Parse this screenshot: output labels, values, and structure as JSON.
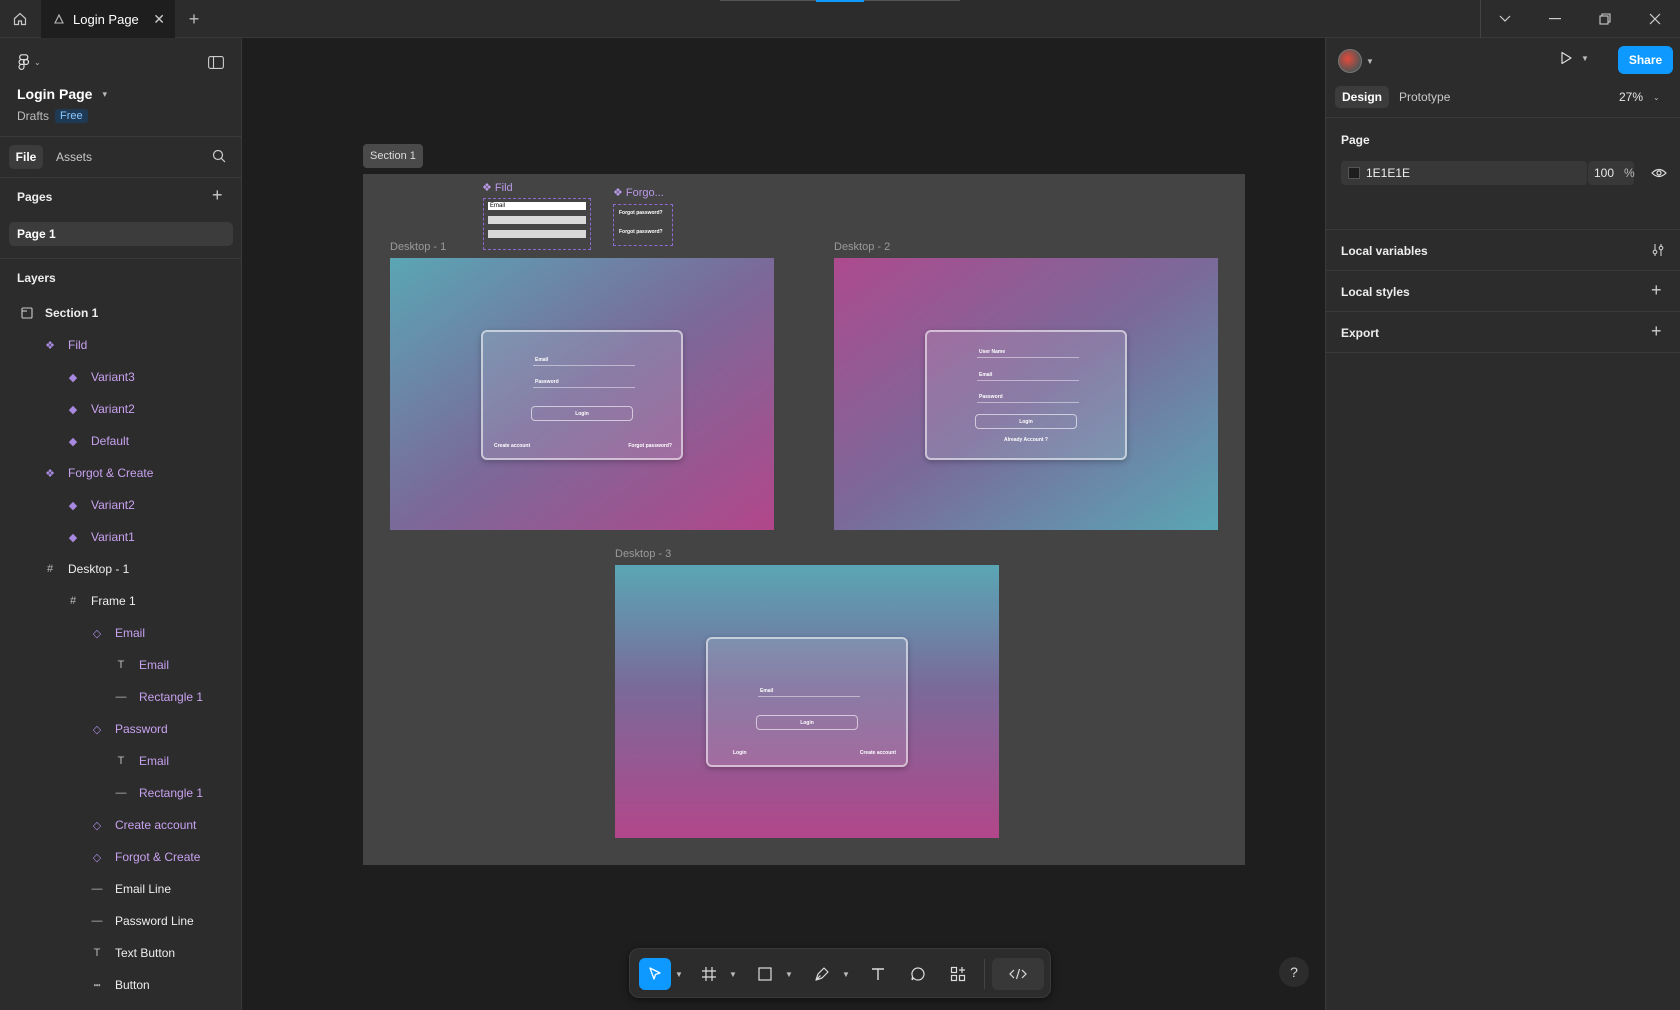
{
  "titlebar": {
    "tab_title": "Login Page"
  },
  "file": {
    "name": "Login Page",
    "location": "Drafts",
    "plan_badge": "Free"
  },
  "left_tabs": {
    "file": "File",
    "assets": "Assets"
  },
  "pages": {
    "header": "Pages",
    "items": [
      "Page 1"
    ]
  },
  "layers": {
    "header": "Layers",
    "items": [
      {
        "label": "Section 1",
        "icon": "section-icon"
      },
      {
        "label": "Fild",
        "icon": "component-set-icon"
      },
      {
        "label": "Variant3",
        "icon": "variant-icon"
      },
      {
        "label": "Variant2",
        "icon": "variant-icon"
      },
      {
        "label": "Default",
        "icon": "variant-icon"
      },
      {
        "label": "Forgot & Create",
        "icon": "component-set-icon"
      },
      {
        "label": "Variant2",
        "icon": "variant-icon"
      },
      {
        "label": "Variant1",
        "icon": "variant-icon"
      },
      {
        "label": "Desktop - 1",
        "icon": "frame-icon"
      },
      {
        "label": "Frame 1",
        "icon": "frame-icon"
      },
      {
        "label": "Email",
        "icon": "instance-icon"
      },
      {
        "label": "Email",
        "icon": "text-icon"
      },
      {
        "label": "Rectangle 1",
        "icon": "line-icon"
      },
      {
        "label": "Password",
        "icon": "instance-icon"
      },
      {
        "label": "Email",
        "icon": "text-icon"
      },
      {
        "label": "Rectangle 1",
        "icon": "line-icon"
      },
      {
        "label": "Create account",
        "icon": "instance-icon"
      },
      {
        "label": "Forgot & Create",
        "icon": "instance-icon"
      },
      {
        "label": "Email Line",
        "icon": "line-icon"
      },
      {
        "label": "Password Line",
        "icon": "line-icon"
      },
      {
        "label": "Text Button",
        "icon": "text-icon"
      },
      {
        "label": "Button",
        "icon": "dashed-line-icon"
      }
    ]
  },
  "canvas": {
    "section_label": "Section 1",
    "fild_label": "Fild",
    "forgot_label": "Forgo...",
    "fild_email": "Email",
    "forgot_1": "Forgot password?",
    "forgot_2": "Forgot password?",
    "desktop1": {
      "label": "Desktop - 1",
      "email": "Email",
      "password": "Password",
      "login_btn": "Login",
      "create": "Create account",
      "forgot": "Forgot password?"
    },
    "desktop2": {
      "label": "Desktop - 2",
      "username": "User Name",
      "email": "Email",
      "password": "Password",
      "login_btn": "Login",
      "already": "Already Account ?"
    },
    "desktop3": {
      "label": "Desktop - 3",
      "email": "Email",
      "login_btn": "Login",
      "login_link": "Login",
      "create": "Create account"
    }
  },
  "right": {
    "share": "Share",
    "tab_design": "Design",
    "tab_prototype": "Prototype",
    "zoom": "27%",
    "page_header": "Page",
    "page_color": "1E1E1E",
    "page_opacity": "100",
    "percent": "%",
    "local_variables": "Local variables",
    "local_styles": "Local styles",
    "export": "Export"
  },
  "colors": {
    "accent": "#0d99ff",
    "page_bg": "#1E1E1E",
    "component_purple": "#c8a2f0"
  }
}
